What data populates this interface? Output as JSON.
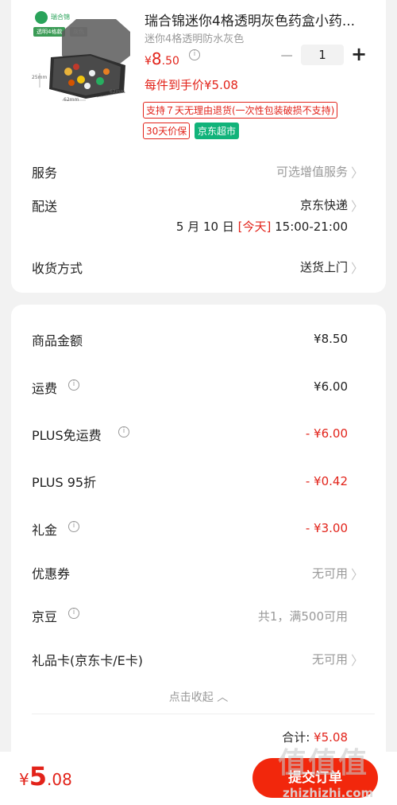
{
  "product": {
    "brand": "瑞合锦",
    "tag_variant": "透明4格款",
    "tag_color": "灰色",
    "dim_height": "25mm",
    "dim_width": "62mm",
    "dim_depth": "62mm",
    "title": "瑞合锦迷你4格透明灰色药盒小药...",
    "subtitle": "迷你4格透明防水灰色",
    "price_currency": "¥",
    "price_int": "8",
    "price_dec": ".50",
    "quantity": "1",
    "net_price": "每件到手价¥5.08",
    "tag_return": "支持７天无理由退货(一次性包装破损不支持)",
    "tag_protect": "30天价保",
    "tag_store": "京东超市"
  },
  "order": {
    "service_label": "服务",
    "service_value": "可选增值服务",
    "delivery_label": "配送",
    "delivery_value": "京东快递",
    "delivery_date": "5 月 10 日",
    "delivery_today": "[今天]",
    "delivery_window": "15:00-21:00",
    "receive_label": "收货方式",
    "receive_value": "送货上门"
  },
  "summary": {
    "goods_label": "商品金额",
    "goods_value": "¥8.50",
    "freight_label": "运费",
    "freight_value": "¥6.00",
    "plus_free_label": "PLUS免运费",
    "plus_free_value": "- ¥6.00",
    "plus_discount_label": "PLUS 95折",
    "plus_discount_value": "- ¥0.42",
    "gift_label": "礼金",
    "gift_value": "- ¥3.00",
    "coupon_label": "优惠券",
    "coupon_value": "无可用",
    "jingdou_label": "京豆",
    "jingdou_value": "共1，满500可用",
    "giftcard_label": "礼品卡(京东卡/E卡)",
    "giftcard_value": "无可用",
    "collapse_label": "点击收起",
    "total_label": "合计: ",
    "total_value": "¥5.08"
  },
  "bottom": {
    "currency": "¥",
    "int": "5",
    "dec": ".08",
    "submit_label": "提交订单"
  },
  "watermark": {
    "main": "值值值",
    "sub": "zhizhizhi.com"
  },
  "colors": {
    "accent_red": "#e2231a",
    "jd_supermarket_green": "#11b37a"
  }
}
